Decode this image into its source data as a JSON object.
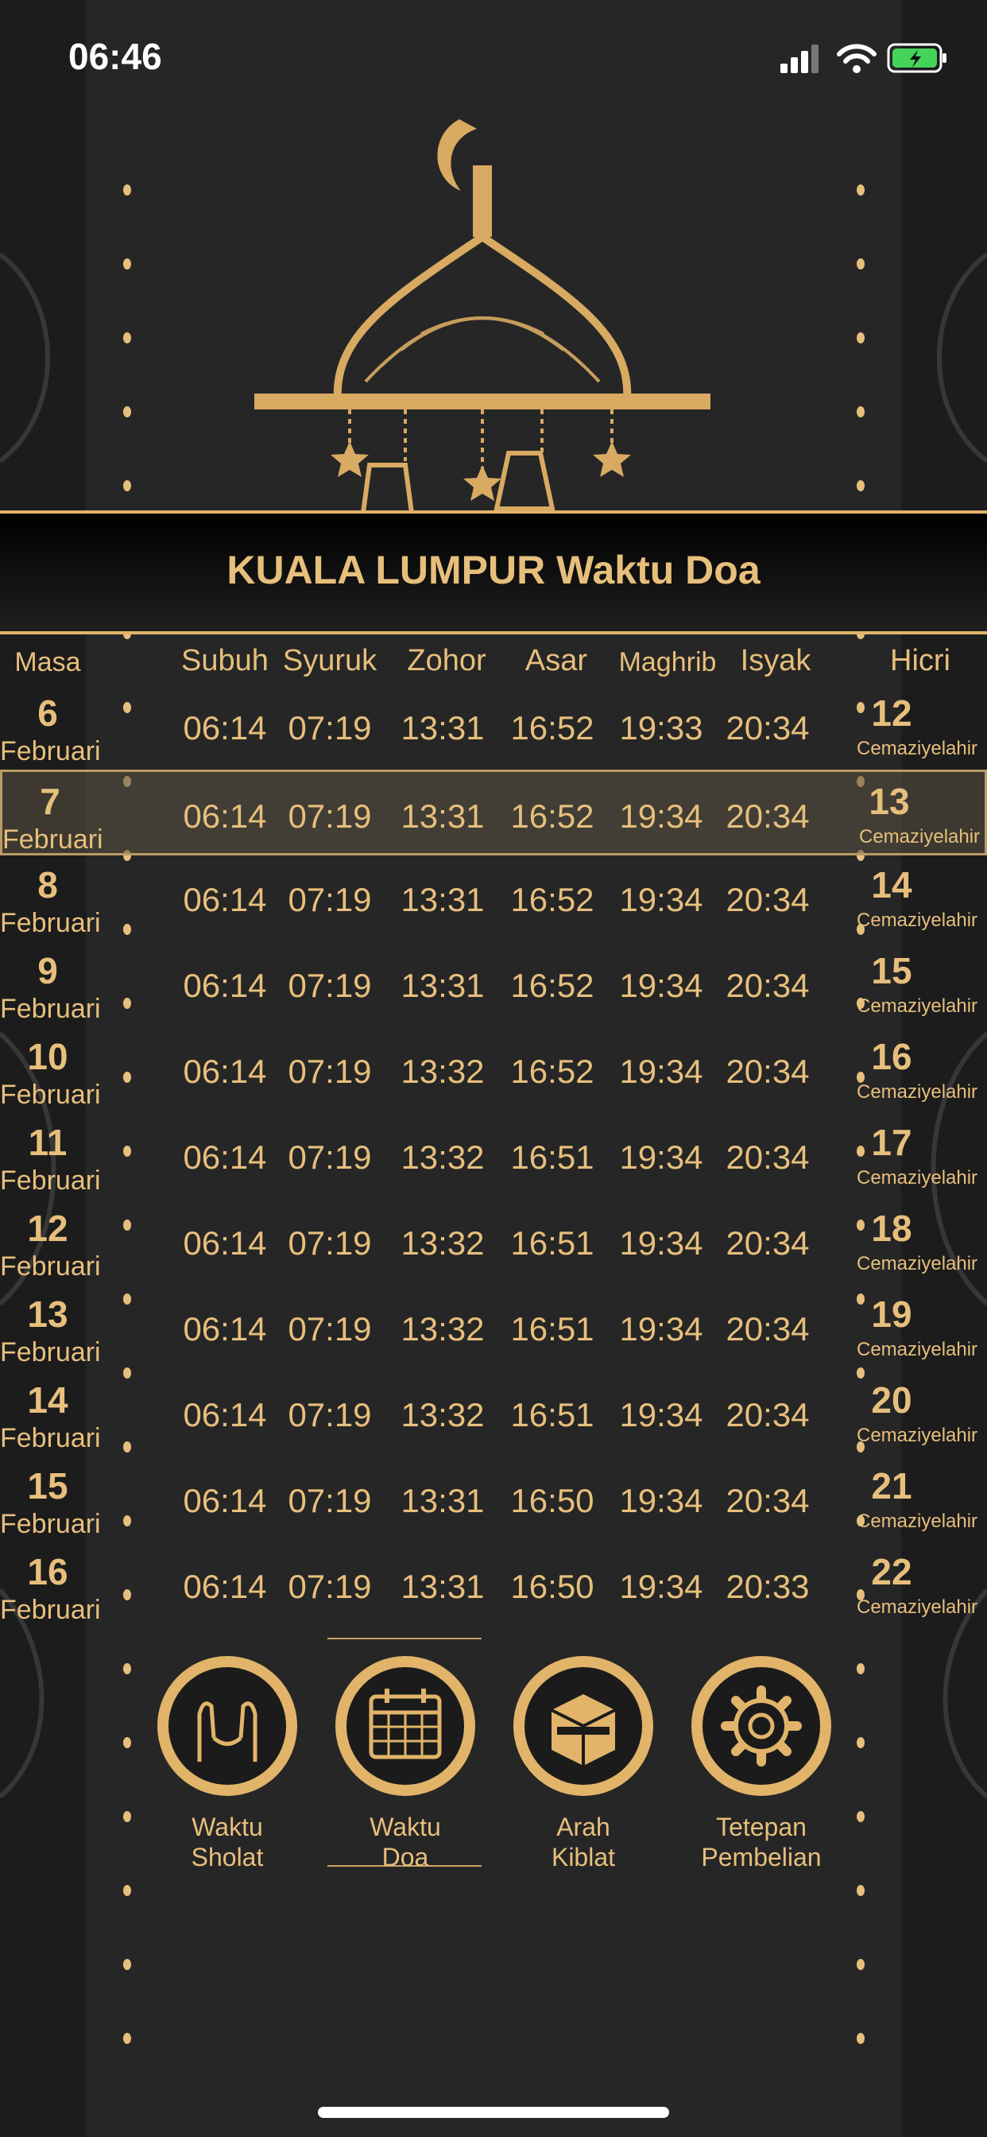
{
  "status": {
    "time": "06:46"
  },
  "title": "KUALA LUMPUR Waktu Doa",
  "headers": {
    "masa": "Masa",
    "subuh": "Subuh",
    "syuruk": "Syuruk",
    "zohor": "Zohor",
    "asar": "Asar",
    "maghrib": "Maghrib",
    "isyak": "Isyak",
    "hicri": "Hicri"
  },
  "rows": [
    {
      "day": "6",
      "month": "Februari",
      "subuh": "06:14",
      "syuruk": "07:19",
      "zohor": "13:31",
      "asar": "16:52",
      "maghrib": "19:33",
      "isyak": "20:34",
      "hicri_day": "12",
      "hicri_month": "Cemaziyelahir"
    },
    {
      "day": "7",
      "month": "Februari",
      "subuh": "06:14",
      "syuruk": "07:19",
      "zohor": "13:31",
      "asar": "16:52",
      "maghrib": "19:34",
      "isyak": "20:34",
      "hicri_day": "13",
      "hicri_month": "Cemaziyelahir"
    },
    {
      "day": "8",
      "month": "Februari",
      "subuh": "06:14",
      "syuruk": "07:19",
      "zohor": "13:31",
      "asar": "16:52",
      "maghrib": "19:34",
      "isyak": "20:34",
      "hicri_day": "14",
      "hicri_month": "Cemaziyelahir"
    },
    {
      "day": "9",
      "month": "Februari",
      "subuh": "06:14",
      "syuruk": "07:19",
      "zohor": "13:31",
      "asar": "16:52",
      "maghrib": "19:34",
      "isyak": "20:34",
      "hicri_day": "15",
      "hicri_month": "Cemaziyelahir"
    },
    {
      "day": "10",
      "month": "Februari",
      "subuh": "06:14",
      "syuruk": "07:19",
      "zohor": "13:32",
      "asar": "16:52",
      "maghrib": "19:34",
      "isyak": "20:34",
      "hicri_day": "16",
      "hicri_month": "Cemaziyelahir"
    },
    {
      "day": "11",
      "month": "Februari",
      "subuh": "06:14",
      "syuruk": "07:19",
      "zohor": "13:32",
      "asar": "16:51",
      "maghrib": "19:34",
      "isyak": "20:34",
      "hicri_day": "17",
      "hicri_month": "Cemaziyelahir"
    },
    {
      "day": "12",
      "month": "Februari",
      "subuh": "06:14",
      "syuruk": "07:19",
      "zohor": "13:32",
      "asar": "16:51",
      "maghrib": "19:34",
      "isyak": "20:34",
      "hicri_day": "18",
      "hicri_month": "Cemaziyelahir"
    },
    {
      "day": "13",
      "month": "Februari",
      "subuh": "06:14",
      "syuruk": "07:19",
      "zohor": "13:32",
      "asar": "16:51",
      "maghrib": "19:34",
      "isyak": "20:34",
      "hicri_day": "19",
      "hicri_month": "Cemaziyelahir"
    },
    {
      "day": "14",
      "month": "Februari",
      "subuh": "06:14",
      "syuruk": "07:19",
      "zohor": "13:32",
      "asar": "16:51",
      "maghrib": "19:34",
      "isyak": "20:34",
      "hicri_day": "20",
      "hicri_month": "Cemaziyelahir"
    },
    {
      "day": "15",
      "month": "Februari",
      "subuh": "06:14",
      "syuruk": "07:19",
      "zohor": "13:31",
      "asar": "16:50",
      "maghrib": "19:34",
      "isyak": "20:34",
      "hicri_day": "21",
      "hicri_month": "Cemaziyelahir"
    },
    {
      "day": "16",
      "month": "Februari",
      "subuh": "06:14",
      "syuruk": "07:19",
      "zohor": "13:31",
      "asar": "16:50",
      "maghrib": "19:34",
      "isyak": "20:33",
      "hicri_day": "22",
      "hicri_month": "Cemaziyelahir"
    }
  ],
  "nav": [
    {
      "label1": "Waktu",
      "label2": "Sholat",
      "icon": "praying-hands-icon"
    },
    {
      "label1": "Waktu",
      "label2": "Doa",
      "icon": "calendar-icon"
    },
    {
      "label1": "Arah",
      "label2": "Kiblat",
      "icon": "kaaba-icon"
    },
    {
      "label1": "Tetepan",
      "label2": "Pembelian",
      "icon": "gear-icon"
    }
  ],
  "colors": {
    "gold": "#e7bf7c",
    "background": "#262626"
  }
}
